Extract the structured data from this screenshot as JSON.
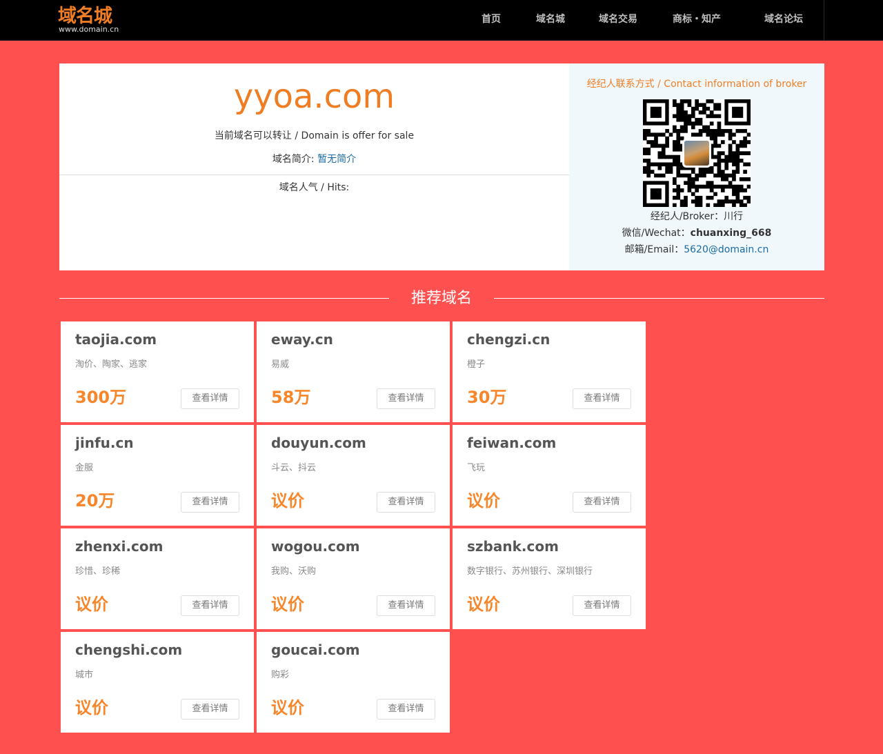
{
  "header": {
    "logo_cn": "域名城",
    "logo_en": "www.domain.cn",
    "nav": [
      {
        "label": "首页"
      },
      {
        "label": "域名城"
      },
      {
        "label": "域名交易"
      },
      {
        "label": "商标・知产"
      },
      {
        "label": "域名论坛"
      }
    ]
  },
  "domain": {
    "name": "yyoa.com",
    "offer_text": "当前域名可以转让 / Domain is offer for sale",
    "intro_label": "域名简介: ",
    "intro_value": "暂无简介",
    "hits_label": "域名人气 / Hits:"
  },
  "broker": {
    "title": "经纪人联系方式 / Contact information of broker",
    "broker_label": "经纪人/Broker：",
    "broker_name": "川行",
    "wechat_label": "微信/Wechat：",
    "wechat_id": "chuanxing_668",
    "email_label": "邮箱/Email：",
    "email": "5620@domain.cn"
  },
  "recommend": {
    "title": "推荐域名",
    "button_label": "查看详情",
    "cards": [
      {
        "name": "taojia.com",
        "desc": "淘价、陶家、逃家",
        "price": "300万"
      },
      {
        "name": "eway.cn",
        "desc": "易威",
        "price": "58万"
      },
      {
        "name": "chengzi.cn",
        "desc": "橙子",
        "price": "30万"
      },
      {
        "name": "jinfu.cn",
        "desc": "金服",
        "price": "20万"
      },
      {
        "name": "douyun.com",
        "desc": "斗云、抖云",
        "price": "议价"
      },
      {
        "name": "feiwan.com",
        "desc": "飞玩",
        "price": "议价"
      },
      {
        "name": "zhenxi.com",
        "desc": "珍惜、珍稀",
        "price": "议价"
      },
      {
        "name": "wogou.com",
        "desc": "我购、沃购",
        "price": "议价"
      },
      {
        "name": "szbank.com",
        "desc": "数字银行、苏州银行、深圳银行",
        "price": "议价"
      },
      {
        "name": "chengshi.com",
        "desc": "城市",
        "price": "议价"
      },
      {
        "name": "goucai.com",
        "desc": "购彩",
        "price": "议价"
      }
    ]
  },
  "colors": {
    "background": "#ff5050",
    "accent": "#ef7d23",
    "price": "#f7862a",
    "link": "#1a6aa5",
    "broker_bg": "#f0f8fc"
  },
  "icons": [
    "qr-code-icon",
    "broker-avatar"
  ]
}
